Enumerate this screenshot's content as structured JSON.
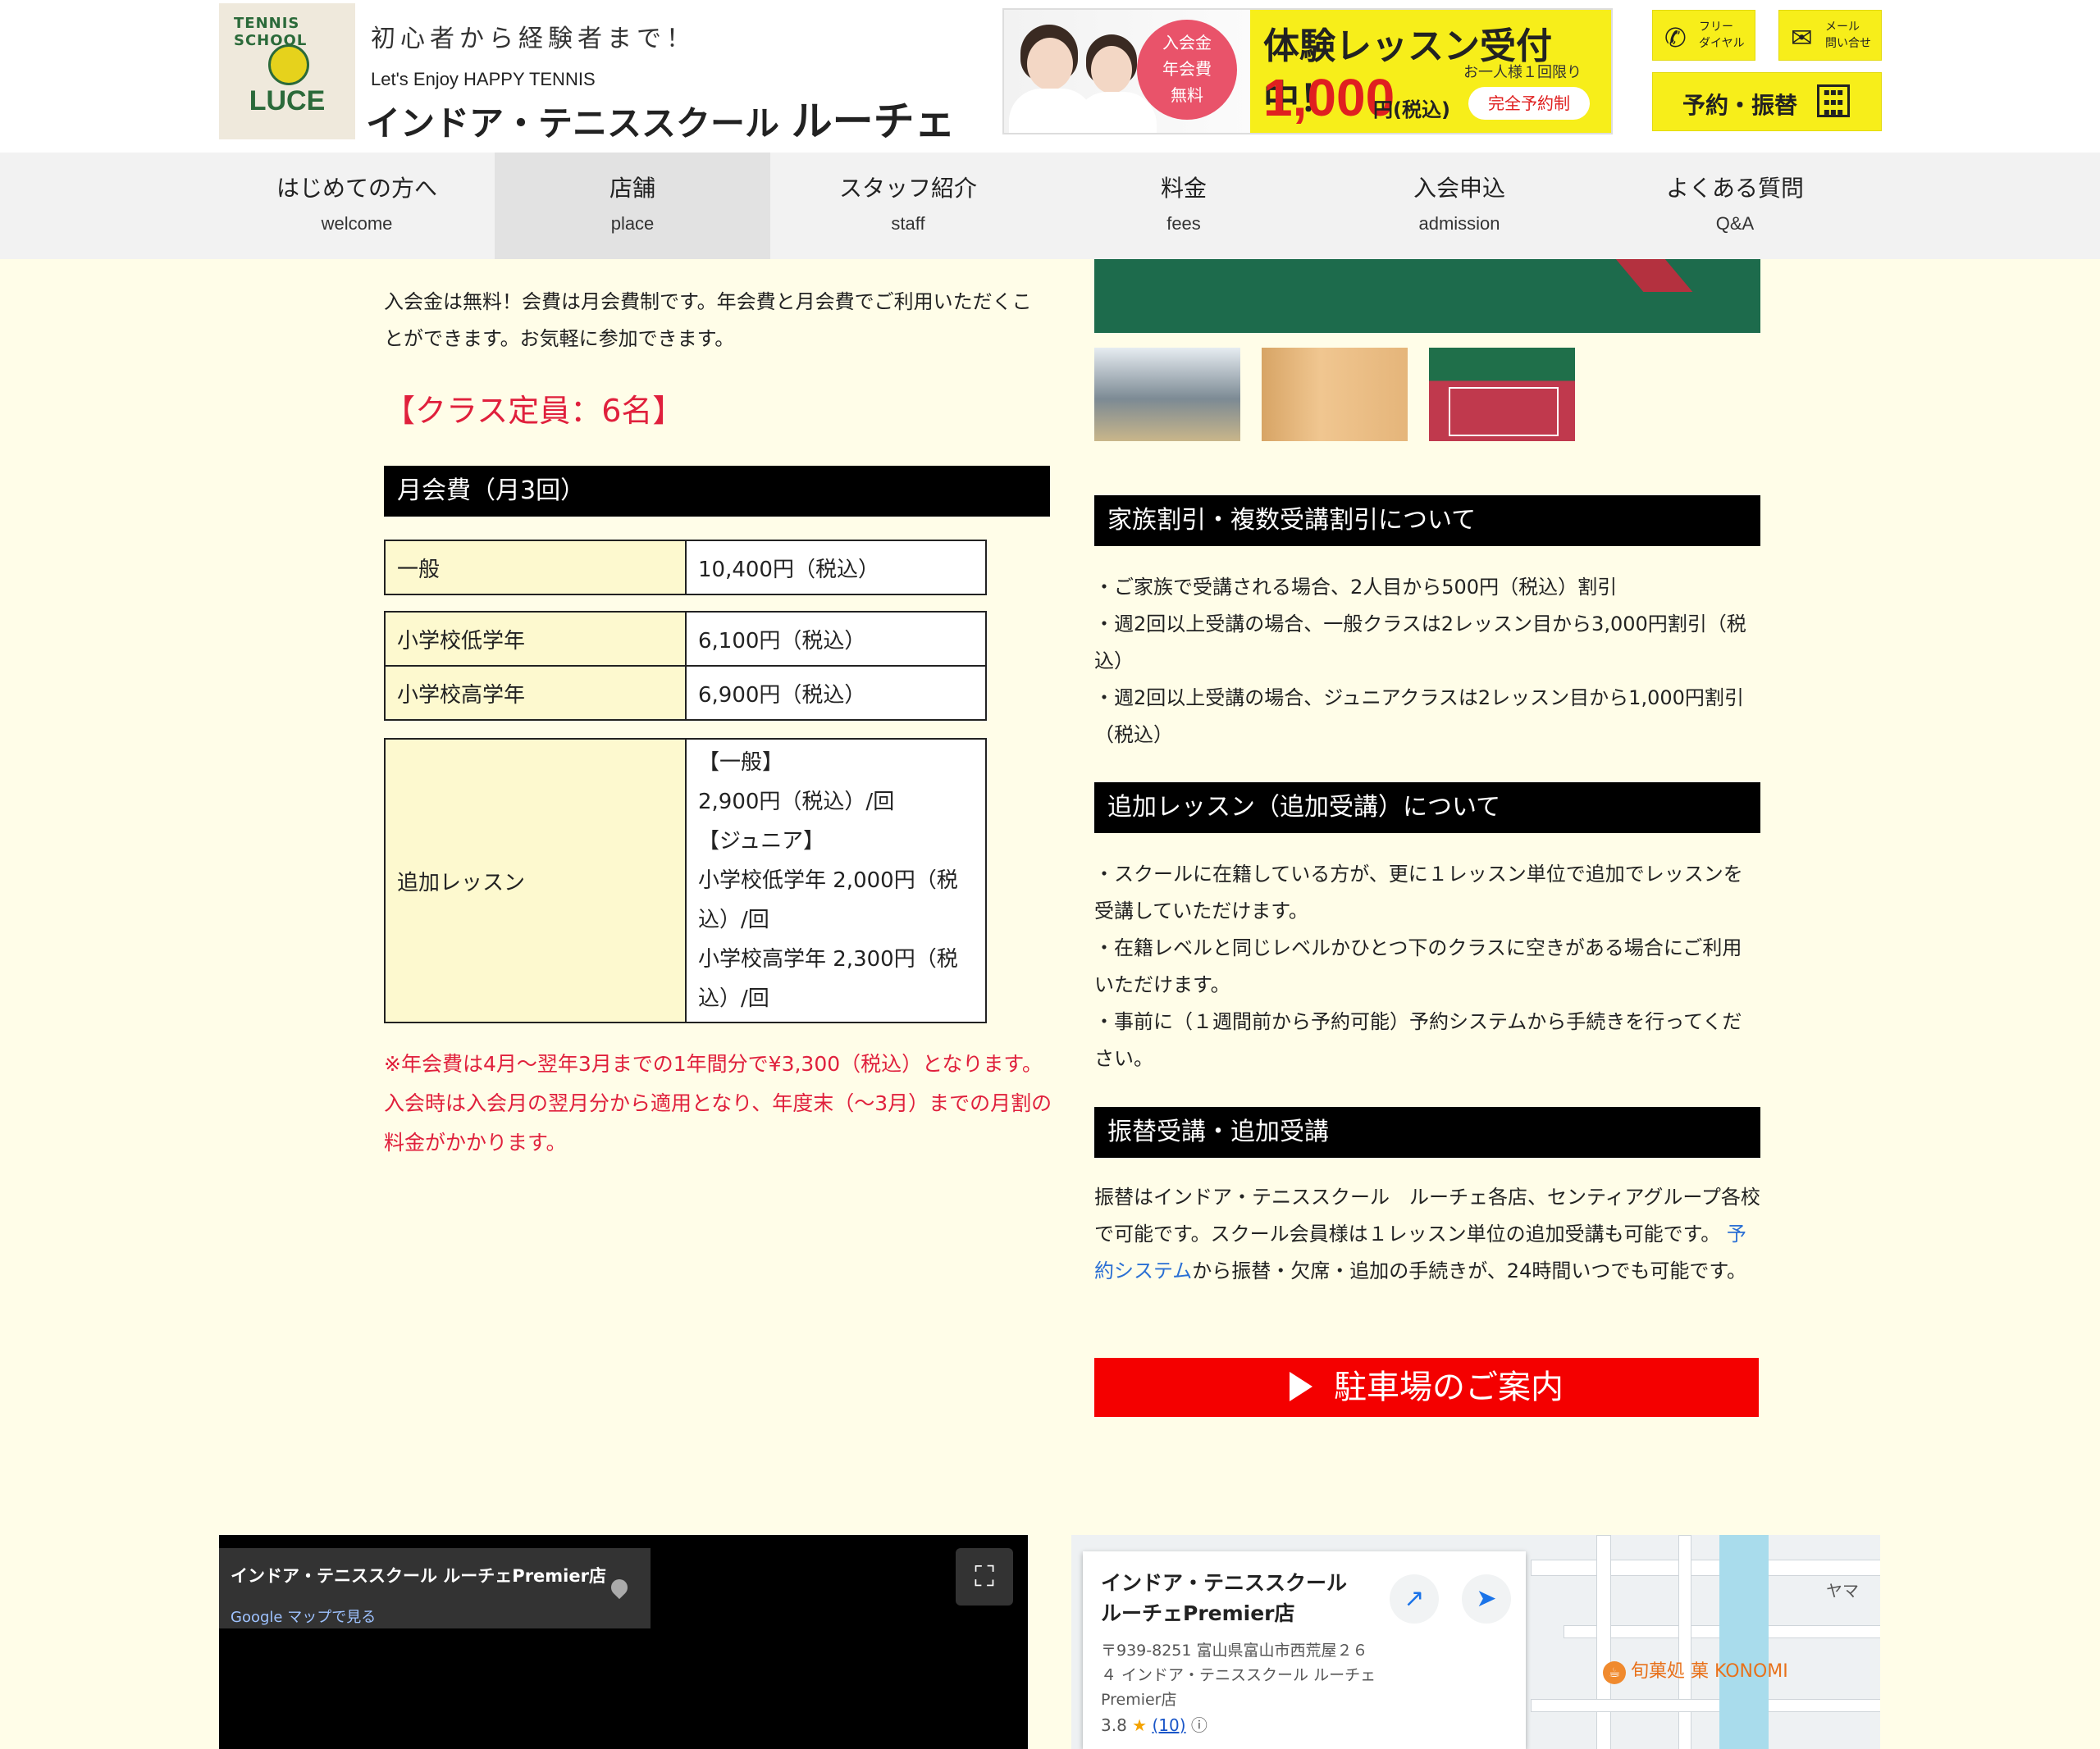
{
  "header": {
    "logo": {
      "arc": "TENNIS SCHOOL",
      "word": "LUCE"
    },
    "tagline": "初心者から経験者まで！",
    "subtagline": "Let's Enjoy HAPPY TENNIS",
    "school_name_prefix": "インドア・テニススクール",
    "school_name_main": "ルーチェ",
    "banner": {
      "badge": "入会金\n年会費\n無料",
      "title": "体験レッスン受付中！",
      "note": "お一人様１回限り",
      "price": "1,000",
      "price_unit": "円(税込)",
      "tag": "完全予約制"
    },
    "free_dial": {
      "icon": "phone-icon",
      "label": "フリー\nダイヤル"
    },
    "mail": {
      "icon": "mail-icon",
      "label": "メール\n問い合せ"
    },
    "reserve": {
      "label": "予約・振替",
      "icon": "calendar-icon"
    }
  },
  "nav": [
    {
      "jp": "はじめての方へ",
      "en": "welcome",
      "active": false
    },
    {
      "jp": "店舗",
      "en": "place",
      "active": true
    },
    {
      "jp": "スタッフ紹介",
      "en": "staff",
      "active": false
    },
    {
      "jp": "料金",
      "en": "fees",
      "active": false
    },
    {
      "jp": "入会申込",
      "en": "admission",
      "active": false
    },
    {
      "jp": "よくある質問",
      "en": "Q&A",
      "active": false
    }
  ],
  "left": {
    "intro": "入会金は無料！会費は月会費制です。年会費と月会費でご利用いただくことができます。お気軽に参加できます。",
    "class_capacity": "【クラス定員：6名】",
    "monthly_heading": "月会費（月3回）",
    "fees": {
      "general": {
        "label": "一般",
        "value": "10,400円（税込）"
      },
      "lower": {
        "label": "小学校低学年",
        "value": "6,100円（税込）"
      },
      "upper": {
        "label": "小学校高学年",
        "value": "6,900円（税込）"
      },
      "extra": {
        "label": "追加レッスン",
        "lines": [
          "【一般】",
          "2,900円（税込）/回",
          "【ジュニア】",
          "小学校低学年 2,000円（税",
          "込）/回",
          "小学校高学年 2,300円（税",
          "込）/回"
        ]
      }
    },
    "note": "※年会費は4月～翌年3月までの1年間分で¥3,300（税込）となります。入会時は入会月の翌月分から適用となり、年度末（～3月）までの月割の料金がかかります。"
  },
  "right": {
    "family_heading": "家族割引・複数受講割引について",
    "family_lines": [
      "・ご家族で受講される場合、2人目から500円（税込）割引",
      "・週2回以上受講の場合、一般クラスは2レッスン目から3,000円割引（税込）",
      "・週2回以上受講の場合、ジュニアクラスは2レッスン目から1,000円割引（税込）"
    ],
    "extra_heading": "追加レッスン（追加受講）について",
    "extra_lines": [
      "・スクールに在籍している方が、更に１レッスン単位で追加でレッスンを受講していただけます。",
      "・在籍レベルと同じレベルかひとつ下のクラスに空きがある場合にご利用いただけます。",
      "・事前に（１週間前から予約可能）予約システムから手続きを行ってください。"
    ],
    "transfer_heading": "振替受講・追加受講",
    "transfer_before": "振替はインドア・テニススクール　ルーチェ各店、センティアグループ各校で可能です。スクール会員様は１レッスン単位の追加受講も可能です。 ",
    "transfer_link": "予約システム",
    "transfer_after": "から振替・欠席・追加の手続きが、24時間いつでも可能です。",
    "parking_label": "駐車場のご案内"
  },
  "map_left": {
    "title": "インドア・テニススクール ルーチェPremier店",
    "link": "Google マップで見る",
    "pin_icon": "location-pin-icon",
    "fullscreen_icon": "fullscreen-icon"
  },
  "map_right": {
    "name": "インドア・テニススクール ルーチェPremier店",
    "address": "〒939-8251 富山県富山市西荒屋２６４ インドア・テニススクール ルーチェPremier店",
    "rating": "3.8",
    "reviews": "(10)",
    "open_icon": "open-external-icon",
    "directions_icon": "directions-icon",
    "poi": "旬菓処 菓 KONOMI",
    "poi_icon": "cafe-icon",
    "edge_label": "ヤマ"
  },
  "colors": {
    "background": "#fffde8",
    "accent_red": "#e0203c",
    "yellow": "#f7ee1a",
    "header_bar": "#000000",
    "parking_red": "#f40000"
  }
}
